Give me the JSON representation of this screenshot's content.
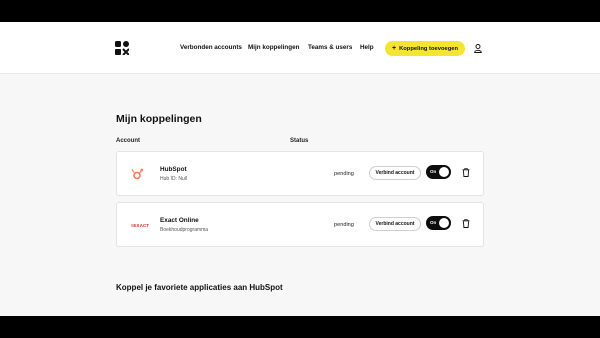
{
  "nav": {
    "items": [
      "Verbonden accounts",
      "Mijn koppelingen",
      "Teams & users",
      "Help"
    ],
    "cta_label": "Koppeling toevoegen",
    "cta_icon": "plus-icon",
    "user_icon": "user-icon"
  },
  "page": {
    "title": "Mijn koppelingen",
    "columns": {
      "account": "Account",
      "status": "Status"
    }
  },
  "connections": [
    {
      "name": "HubSpot",
      "subtitle": "Hub ID: Null",
      "status": "pending",
      "connect_label": "Verbind account",
      "toggle_label": "On",
      "logo": "hubspot-logo",
      "logo_color": "#ff7a59"
    },
    {
      "name": "Exact Online",
      "subtitle": "Boekhoudprogramma",
      "status": "pending",
      "connect_label": "Verbind account",
      "toggle_label": "On",
      "logo": "exact-logo",
      "logo_text": "≡EXACT",
      "logo_color": "#e1251b"
    }
  ],
  "section": {
    "title": "Koppel je favoriete applicaties aan HubSpot"
  },
  "colors": {
    "accent": "#f5e431",
    "toggle_bg": "#0d0d0d",
    "background": "#f7f7f7"
  }
}
